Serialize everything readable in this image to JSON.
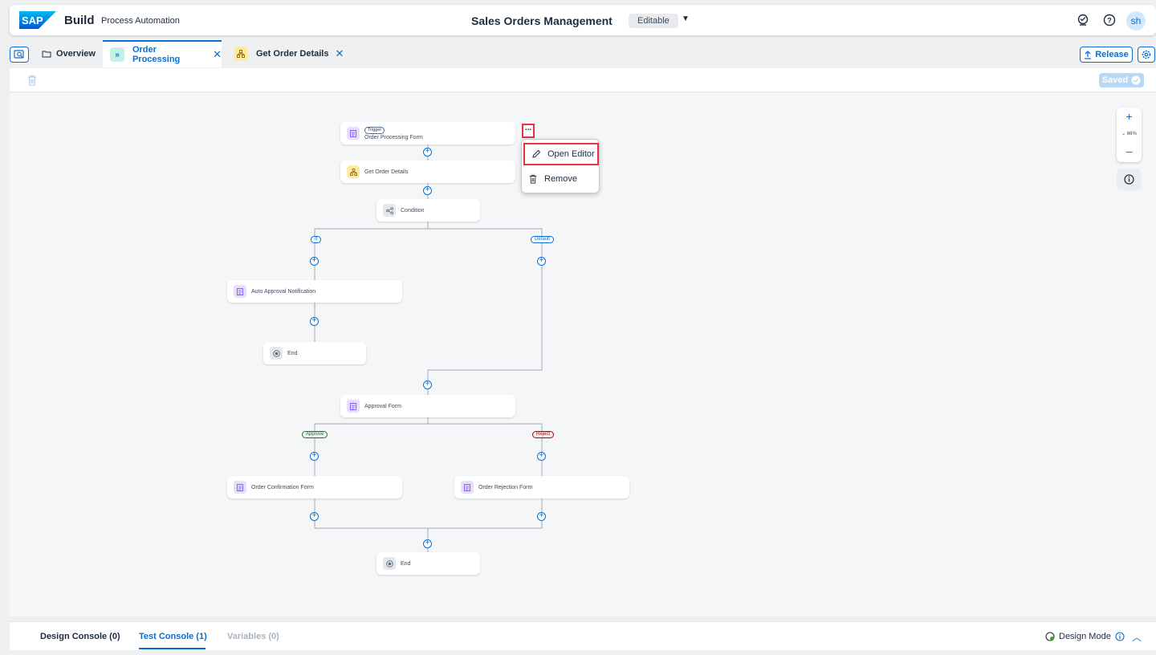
{
  "header": {
    "logo_text": "SAP",
    "brand": "Build",
    "product": "Process Automation",
    "project_title": "Sales Orders Management",
    "status": "Editable",
    "user_initials": "sh"
  },
  "tabs": [
    {
      "label": "Overview"
    },
    {
      "label": "Order Processing"
    },
    {
      "label": "Get Order Details"
    }
  ],
  "toolbar": {
    "release_label": "Release",
    "saved_label": "Saved"
  },
  "flow": {
    "trigger_tag": "Trigger",
    "nodes": {
      "order_processing_form": "Order Processing Form",
      "get_order_details": "Get Order Details",
      "condition": "Condition",
      "auto_approval_notification": "Auto Approval Notification",
      "end_1": "End",
      "approval_form": "Approval Form",
      "order_confirmation_form": "Order Confirmation Form",
      "order_rejection_form": "Order Rejection Form",
      "end_2": "End"
    },
    "branches": {
      "if": "If",
      "default": "Default",
      "approve": "Approve",
      "reject": "Reject"
    },
    "more_label": "...",
    "context_menu": {
      "open_editor": "Open Editor",
      "remove": "Remove"
    }
  },
  "zoom": {
    "level": "66%"
  },
  "console": {
    "tabs": [
      {
        "label": "Design Console (0)"
      },
      {
        "label": "Test Console (1)"
      },
      {
        "label": "Variables (0)"
      }
    ],
    "mode_label": "Design Mode"
  },
  "colors": {
    "accent": "#0a6ed1",
    "highlight": "#e5323b"
  }
}
